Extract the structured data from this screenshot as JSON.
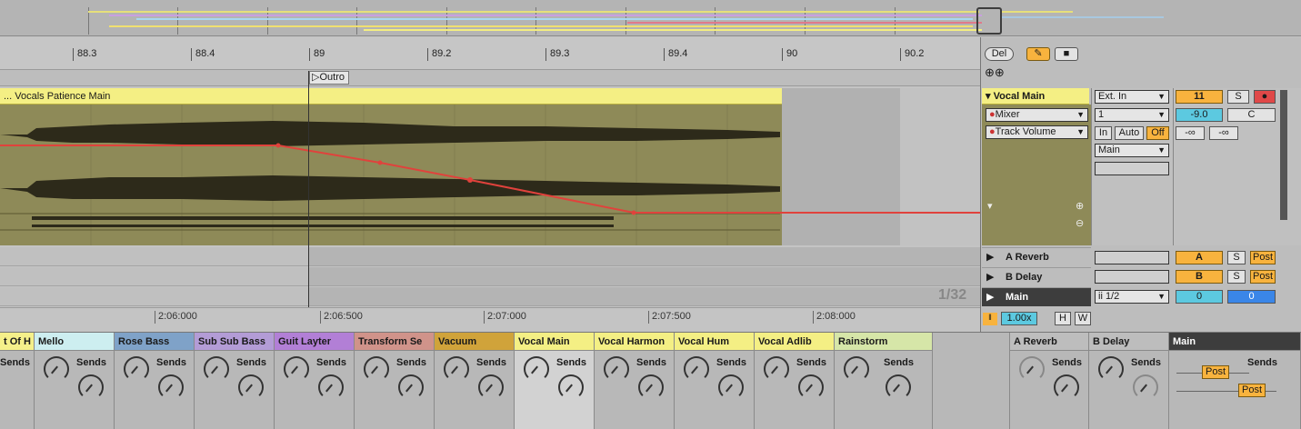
{
  "ruler": {
    "bars": [
      "88.3",
      "88.4",
      "89",
      "89.2",
      "89.3",
      "89.4",
      "90",
      "90.2"
    ]
  },
  "locator": {
    "label": "Outro"
  },
  "clip": {
    "name": "... Vocals Patience Main",
    "color": "#f4ef84"
  },
  "timeline": {
    "times": [
      "2:06:000",
      "2:06:500",
      "2:07:000",
      "2:07:500",
      "2:08:000"
    ],
    "grid_quantize": "1/32"
  },
  "controls": {
    "del_label": "Del"
  },
  "track": {
    "name": "Vocal Main",
    "device": "Mixer",
    "parameter": "Track Volume",
    "input_type": "Ext. In",
    "input_channel": "1",
    "monitor": [
      "In",
      "Auto",
      "Off"
    ],
    "output": "Main",
    "track_number": "11",
    "solo": "S",
    "volume": "-9.0",
    "pan": "C",
    "peak_l": "-∞",
    "peak_r": "-∞"
  },
  "returns": [
    {
      "name": "A Reverb",
      "letter": "A",
      "solo": "S",
      "post": "Post"
    },
    {
      "name": "B Delay",
      "letter": "B",
      "solo": "S",
      "post": "Post"
    }
  ],
  "main": {
    "name": "Main",
    "routing": "ii 1/2",
    "vol_l": "0",
    "vol_r": "0"
  },
  "zoom": {
    "value": "1.00x",
    "h": "H",
    "w": "W"
  },
  "mixer": {
    "sends_label": "Sends",
    "channels": [
      {
        "name": "t Of H",
        "color": "#f5f08a"
      },
      {
        "name": "Mello",
        "color": "#cdeef0"
      },
      {
        "name": "Rose Bass",
        "color": "#7fa2c8"
      },
      {
        "name": "Sub Sub Bass",
        "color": "#b39cd6"
      },
      {
        "name": "Guit Layter",
        "color": "#b27fd6"
      },
      {
        "name": "Transform Se",
        "color": "#d0938a"
      },
      {
        "name": "Vacuum",
        "color": "#d0a33a"
      },
      {
        "name": "Vocal Main",
        "color": "#f4ef84"
      },
      {
        "name": "Vocal Harmon",
        "color": "#f4ef84"
      },
      {
        "name": "Vocal Hum",
        "color": "#f4ef84"
      },
      {
        "name": "Vocal Adlib",
        "color": "#f4ef84"
      },
      {
        "name": "Rainstorm",
        "color": "#d6e6a8"
      }
    ],
    "returns": [
      {
        "name": "A Reverb",
        "color": "#bdbdbd"
      },
      {
        "name": "B Delay",
        "color": "#bdbdbd"
      },
      {
        "name": "Main",
        "color": "#3d3d3d"
      }
    ],
    "post_label": "Post"
  }
}
